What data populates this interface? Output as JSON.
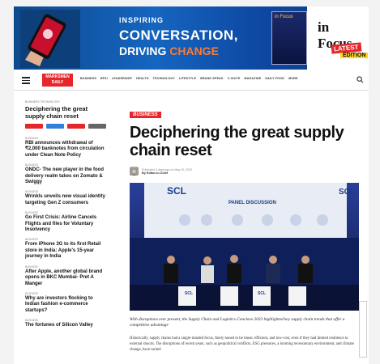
{
  "banner": {
    "inspiring": "INSPIRING",
    "conversation": "CONVERSATION,",
    "driving": "DRIVING",
    "change": "CHANGE",
    "magazine_label": "in Focus",
    "in_focus": "in Focus",
    "latest": "LATEST",
    "edition": "EDITION"
  },
  "nav": {
    "logo_line1": "MARKSMEN",
    "logo_line2": "DAILY",
    "items": [
      "BUSINESS",
      "BFSI",
      "LEADERSHIP",
      "HEALTH",
      "TECHNOLOGY",
      "LIFESTYLE",
      "BRAND SPEAK",
      "C-SUITE",
      "MAGAZINE",
      "DAILY FOOD",
      "MORE"
    ]
  },
  "sidebar": {
    "category": "BUSINESS TECHNOLOGY",
    "title": "Deciphering the great supply chain reset",
    "share_colors": [
      "#e6262a",
      "#2f80d6",
      "#e6262a",
      "#666666"
    ],
    "items": [
      {
        "cat": "BUSINESS",
        "title": "RBI announces withdrawal of ₹2,000 banknotes from circulation under Clean Note Policy"
      },
      {
        "cat": "BUSINESS",
        "title": "ONDC- The new player in the food delivery realm takes on Zomato & Swiggy"
      },
      {
        "cat": "BUSINESS",
        "title": "Wrinkls unveils new visual identity targeting Gen Z consumers"
      },
      {
        "cat": "BUSINESS",
        "title": "Go First Crisis: Airline Cancels Flights and files for Voluntary Insolvency"
      },
      {
        "cat": "BUSINESS",
        "title": "From iPhone 3G to its first Retail store in India: Apple's 15-year journey in India"
      },
      {
        "cat": "BUSINESS",
        "title": "After Apple, another global brand opens in BKC Mumbai- Pret A Manger"
      },
      {
        "cat": "BUSINESS",
        "title": "Why are investors flocking to Indian fashion e-commerce startups?"
      },
      {
        "cat": "BUSINESS",
        "title": "The fortunes of Silicon Valley"
      }
    ]
  },
  "article": {
    "badge": "BUSINESS",
    "title": "Deciphering the great supply chain reset",
    "published": "Published 4 days ago on May 20, 2023",
    "author": "By Editor-in-Chief",
    "photo_scl": "SCL",
    "photo_panel": "PANEL DISCUSSION",
    "caption": "With disruptions ever present, the Supply Chain and Logistics Conclave 2023 highlighted key supply chain trends that offer a competitive advantage",
    "body": "Historically, supply chains had a single-minded focus, finely honed to be linear, efficient, and low-cost, even if they had limited resilience to external shocks. The disruptions of recent years, such as geopolitical conflicts, ESG pressures, a looming recessionary environment, and climate change, have turned"
  },
  "colors": {
    "accent": "#e6262a",
    "banner": "#0e4a8e",
    "orange": "#ff7a2e"
  }
}
